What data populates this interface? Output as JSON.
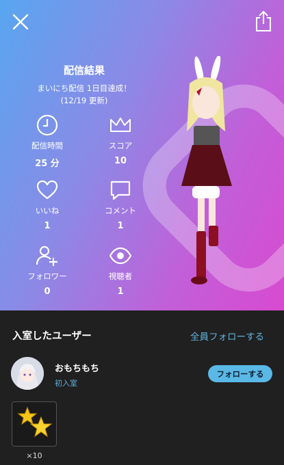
{
  "header": {
    "title": "配信結果",
    "subtitle": "まいにち配信 1日目達成！",
    "updated": "(12/19 更新)"
  },
  "stats": [
    {
      "icon": "clock-icon",
      "label": "配信時間",
      "value": "25 分"
    },
    {
      "icon": "crown-icon",
      "label": "スコア",
      "value": "10"
    },
    {
      "icon": "heart-icon",
      "label": "いいね",
      "value": "1"
    },
    {
      "icon": "comment-icon",
      "label": "コメント",
      "value": "1"
    },
    {
      "icon": "add-user-icon",
      "label": "フォロワー",
      "value": "0"
    },
    {
      "icon": "eye-icon",
      "label": "視聴者",
      "value": "1"
    }
  ],
  "users_section": {
    "title": "入室したユーザー",
    "follow_all": "全員フォローする",
    "users": [
      {
        "name": "おもちもち",
        "status": "初入室",
        "follow_label": "フォローする"
      }
    ]
  },
  "gifts": [
    {
      "icon": "stars-icon",
      "count": "×10"
    }
  ],
  "colors": {
    "accent": "#5fb3df",
    "follow_button": "#5ab8e6",
    "background": "#202020"
  }
}
